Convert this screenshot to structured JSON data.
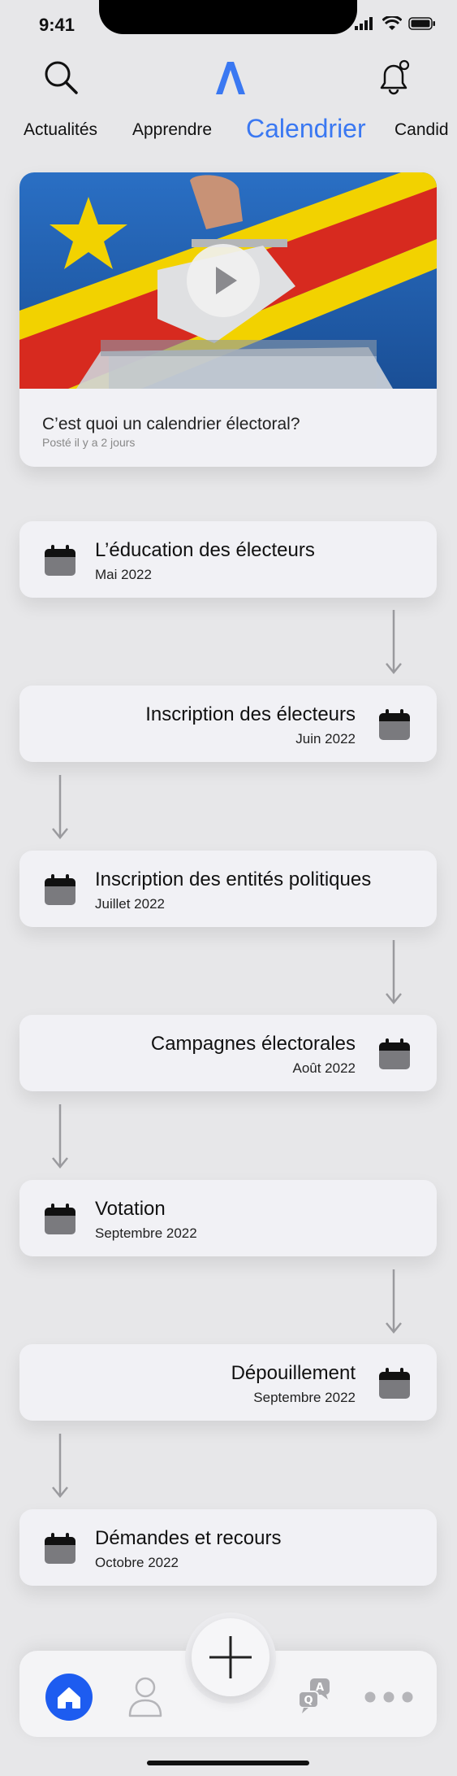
{
  "status_bar": {
    "time": "9:41"
  },
  "header": {
    "tabs": [
      {
        "label": "Actualités"
      },
      {
        "label": "Apprendre"
      },
      {
        "label": "Calendrier"
      },
      {
        "label": "Candid"
      }
    ],
    "active_tab": "Calendrier"
  },
  "video": {
    "title": "C’est quoi un calendrier électoral?",
    "meta": "Posté il y a 2 jours"
  },
  "timeline": [
    {
      "title": "L’éducation des électeurs",
      "date": "Mai 2022",
      "align": "left"
    },
    {
      "title": "Inscription des électeurs",
      "date": "Juin 2022",
      "align": "right"
    },
    {
      "title": "Inscription des entités politiques",
      "date": "Juillet 2022",
      "align": "left"
    },
    {
      "title": "Campagnes électorales",
      "date": "Août 2022",
      "align": "right"
    },
    {
      "title": "Votation",
      "date": "Septembre 2022",
      "align": "left"
    },
    {
      "title": "Dépouillement",
      "date": "Septembre 2022",
      "align": "right"
    },
    {
      "title": "Démandes et recours",
      "date": "Octobre 2022",
      "align": "left"
    }
  ],
  "bottom_nav": {
    "items": [
      "home-icon",
      "profile-icon",
      "add-icon",
      "qa-icon",
      "more-icon"
    ],
    "active": "home-icon",
    "qa_letters": {
      "q": "Q",
      "a": "A"
    }
  },
  "colors": {
    "accent": "#3a78f2",
    "home": "#1d5cf0",
    "card": "#f1f1f5",
    "background": "#e7e7e9"
  }
}
